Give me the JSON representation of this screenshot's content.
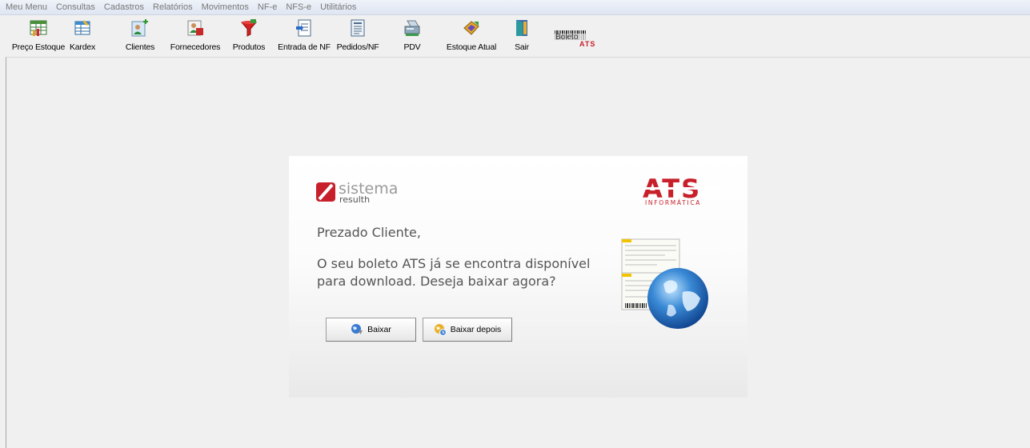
{
  "menu": [
    "Meu Menu",
    "Consultas",
    "Cadastros",
    "Relatórios",
    "Movimentos",
    "NF-e",
    "NFS-e",
    "Utilitários"
  ],
  "toolbar": {
    "preco_estoque": "Preço Estoque",
    "kardex": "Kardex",
    "clientes": "Clientes",
    "fornecedores": "Fornecedores",
    "produtos": "Produtos",
    "entrada_nf": "Entrada de NF",
    "pedidos_nf": "Pedidos/NF",
    "pdv": "PDV",
    "estoque_atual": "Estoque Atual",
    "sair": "Sair",
    "boleto_logo_text": "Boleto",
    "boleto_logo_brand": "ATS"
  },
  "dialog": {
    "brand_left_title": "sistema",
    "brand_left_sub": "resulth",
    "brand_right_title": "ATS",
    "brand_right_sub": "INFORMÁTICA",
    "greeting": "Prezado Cliente,",
    "message": "O seu boleto ATS já se encontra disponível para download. Deseja baixar agora?",
    "btn_baixar": "Baixar",
    "btn_baixar_depois": "Baixar depois"
  },
  "colors": {
    "brand_red": "#c8202a",
    "menu_text": "#777777",
    "dialog_text": "#555555"
  }
}
